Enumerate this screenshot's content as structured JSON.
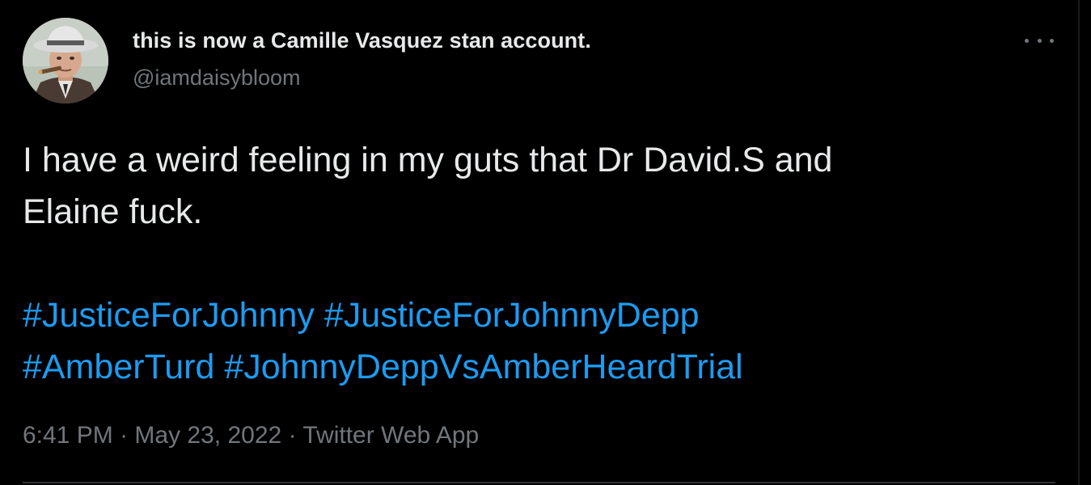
{
  "author": {
    "display_name": "this is now a Camille Vasquez stan account.",
    "handle": "@iamdaisybloom"
  },
  "tweet": {
    "text_line1": "I have a weird feeling in my guts that Dr David.S and",
    "text_line2": "Elaine fuck.",
    "hashtags": [
      "#JusticeForJohnny",
      "#JusticeForJohnnyDepp",
      "#AmberTurd",
      "#JohnnyDeppVsAmberHeardTrial"
    ]
  },
  "meta": {
    "time": "6:41 PM",
    "date": "May 23, 2022",
    "separator": "·",
    "source": "Twitter Web App"
  },
  "icons": {
    "more": "more-options-icon",
    "avatar": "avatar"
  },
  "colors": {
    "background": "#000000",
    "text": "#e7e9ea",
    "muted": "#71767b",
    "hashtag": "#1d9bf0"
  }
}
